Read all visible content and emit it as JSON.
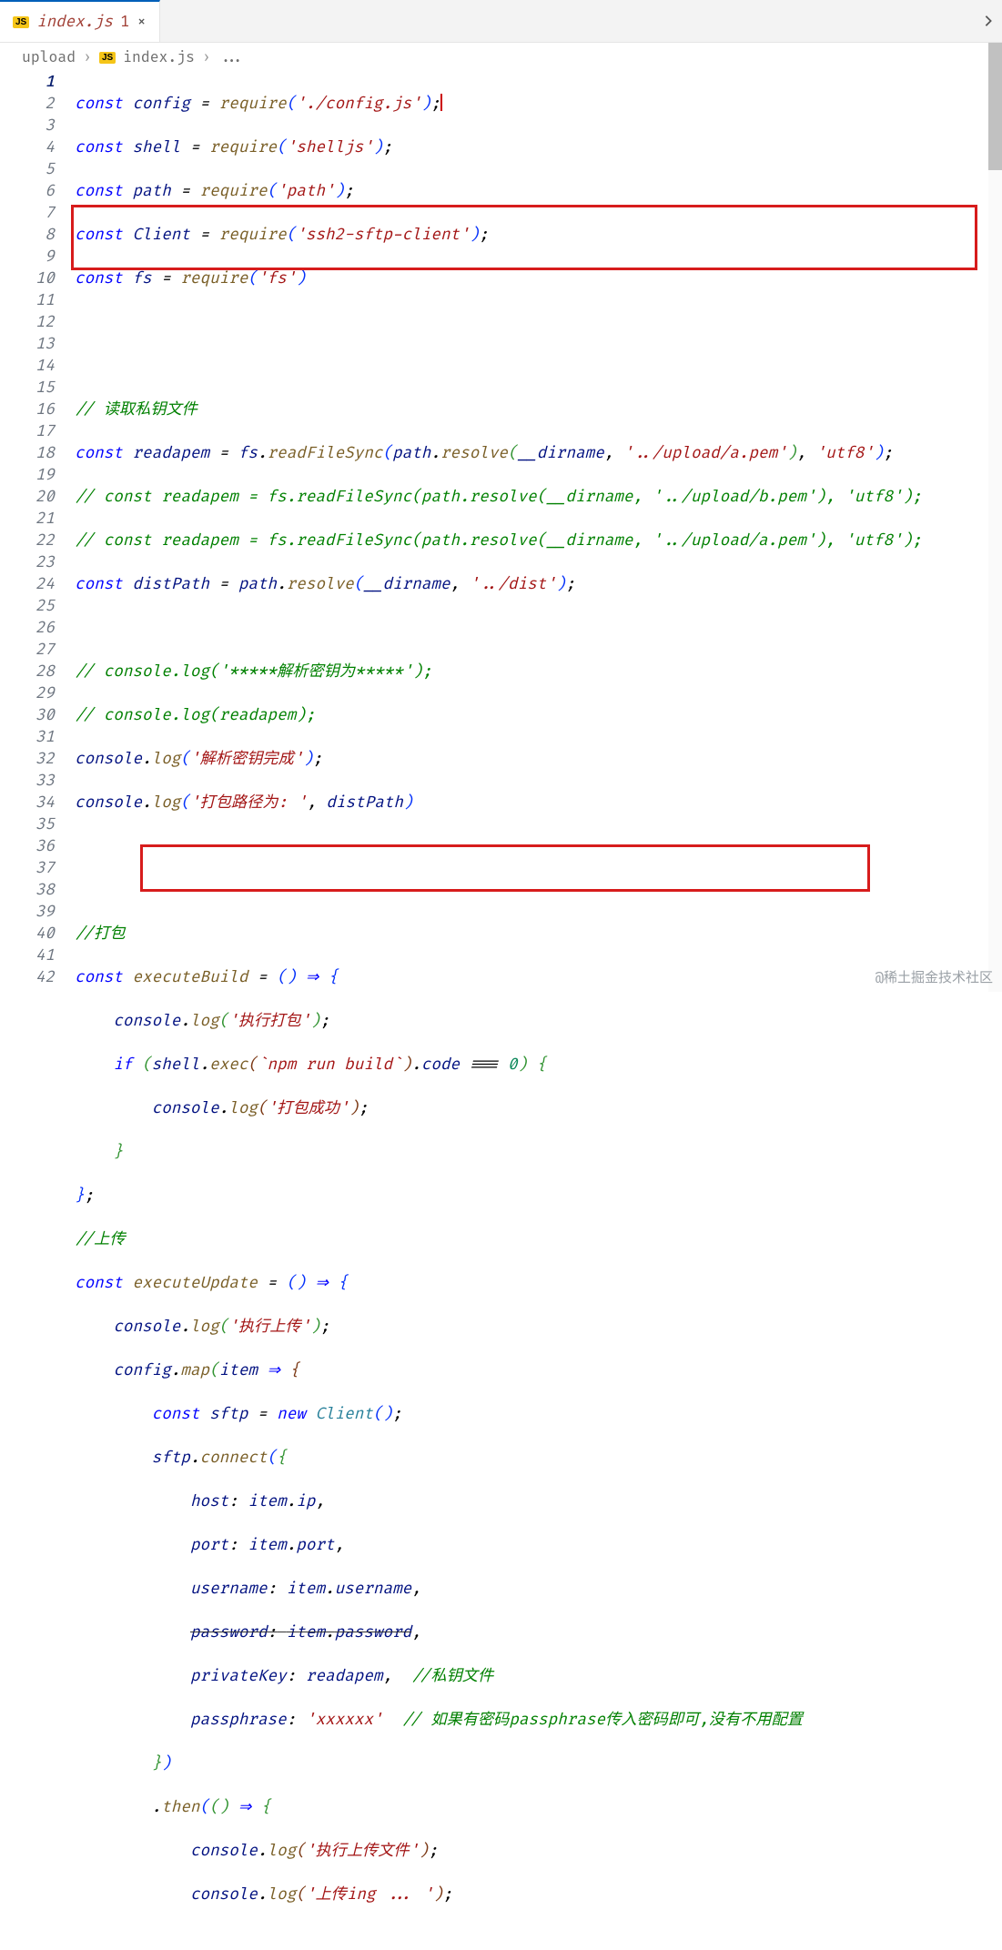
{
  "tab": {
    "filename": "index.js",
    "badge": "1",
    "icon_text": "JS"
  },
  "breadcrumb": {
    "folder": "upload",
    "file": "index.js",
    "more": "...",
    "icon_text": "JS"
  },
  "lines": {
    "start": 1,
    "count": 42,
    "active": 1
  },
  "code": {
    "l1_config": "config",
    "l1_require": "require",
    "l1_arg": "'./config.js'",
    "l2_shell": "shell",
    "l2_arg": "'shelljs'",
    "l3_path": "path",
    "l3_arg": "'path'",
    "l4_client": "Client",
    "l4_arg": "'ssh2-sftp-client'",
    "l5_fs": "fs",
    "l5_arg": "'fs'",
    "l8_comment": "// 读取私钥文件",
    "l9_readapem": "readapem",
    "l9_readFileSync": "readFileSync",
    "l9_resolve": "resolve",
    "l9_dirname": "__dirname",
    "l9_path": "'../upload/a.pem'",
    "l9_enc": "'utf8'",
    "l10_comment": "// const readapem = fs.readFileSync(path.resolve(__dirname, '../upload/b.pem'), 'utf8');",
    "l11_comment": "// const readapem = fs.readFileSync(path.resolve(__dirname, '../upload/a.pem'), 'utf8');",
    "l12_distPath": "distPath",
    "l12_arg": "'../dist'",
    "l14_comment": "// console.log('*****解析密钥为*****');",
    "l15_comment": "// console.log(readapem);",
    "l16_msg": "'解析密钥完成'",
    "l17_msg": "'打包路径为: '",
    "l17_arg2": "distPath",
    "l20_comment": "//打包",
    "l21_executeBuild": "executeBuild",
    "l22_msg": "'执行打包'",
    "l23_cmd": "`npm run build`",
    "l23_code": "code",
    "l23_zero": "0",
    "l24_msg": "'打包成功'",
    "l27_comment": "//上传",
    "l28_executeUpdate": "executeUpdate",
    "l29_msg": "'执行上传'",
    "l30_map": "map",
    "l30_item": "item",
    "l31_sftp": "sftp",
    "l31_new": "new",
    "l32_connect": "connect",
    "l33_host": "host",
    "l33_ip": "ip",
    "l34_port": "port",
    "l35_username": "username",
    "l36_password": "password",
    "l37_privateKey": "privateKey",
    "l37_comment": "//私钥文件",
    "l38_passphrase": "passphrase",
    "l38_val": "'xxxxxx'",
    "l38_comment": "// 如果有密码passphrase传入密码即可,没有不用配置",
    "l40_then": "then",
    "l41_msg": "'执行上传文件'",
    "l42_msg": "'上传ing ... '"
  },
  "watermark": "@稀土掘金技术社区",
  "const": "const",
  "if": "if",
  "console": "console",
  "log": "log",
  "exec": "exec",
  "item": "item"
}
